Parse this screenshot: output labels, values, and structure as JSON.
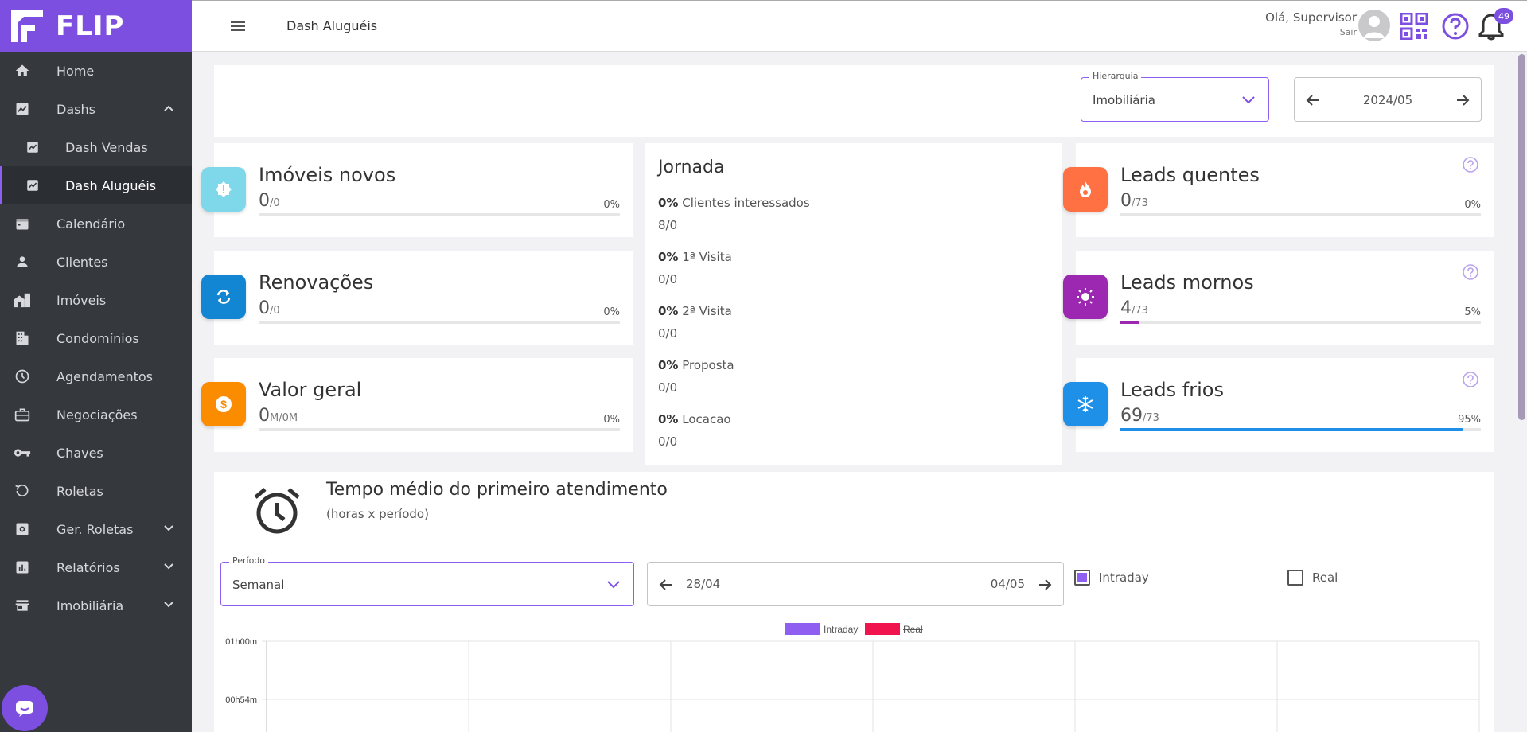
{
  "brand": {
    "name": "FLIP",
    "accent": "#7d4fe0"
  },
  "sidebar": {
    "items": [
      {
        "label": "Home",
        "icon": "home-icon"
      },
      {
        "label": "Dashs",
        "icon": "chart-icon"
      },
      {
        "label": "Dash Vendas",
        "icon": "chart-icon"
      },
      {
        "label": "Dash Aluguéis",
        "icon": "chart-icon"
      },
      {
        "label": "Calendário",
        "icon": "calendar-icon"
      },
      {
        "label": "Clientes",
        "icon": "person-icon"
      },
      {
        "label": "Imóveis",
        "icon": "buildings-icon"
      },
      {
        "label": "Condomínios",
        "icon": "apartment-icon"
      },
      {
        "label": "Agendamentos",
        "icon": "clock-icon"
      },
      {
        "label": "Negociações",
        "icon": "briefcase-icon"
      },
      {
        "label": "Chaves",
        "icon": "key-icon"
      },
      {
        "label": "Roletas",
        "icon": "rotate-icon"
      },
      {
        "label": "Ger. Roletas",
        "icon": "settings-box-icon"
      },
      {
        "label": "Relatórios",
        "icon": "report-icon"
      },
      {
        "label": "Imobiliária",
        "icon": "store-icon"
      }
    ]
  },
  "topbar": {
    "title": "Dash Aluguéis",
    "greeting": "Olá, Supervisor",
    "logout": "Sair",
    "notifications": "49"
  },
  "filters": {
    "hierarchy_label": "Hierarquia",
    "hierarchy_value": "Imobiliária",
    "period_value": "2024/05"
  },
  "cards": {
    "imoveis": {
      "title": "Imóveis novos",
      "value": "0",
      "total": "/0",
      "pct": "0%",
      "fill": 0
    },
    "renovacoes": {
      "title": "Renovações",
      "value": "0",
      "total": "/0",
      "pct": "0%",
      "fill": 0
    },
    "valor": {
      "title": "Valor geral",
      "value": "0",
      "total": "M/0M",
      "pct": "0%",
      "fill": 0
    },
    "quentes": {
      "title": "Leads quentes",
      "value": "0",
      "total": "/73",
      "pct": "0%",
      "fill": 0
    },
    "mornos": {
      "title": "Leads mornos",
      "value": "4",
      "total": "/73",
      "pct": "5%",
      "fill": 0.05
    },
    "frios": {
      "title": "Leads frios",
      "value": "69",
      "total": "/73",
      "pct": "95%",
      "fill": 0.95
    }
  },
  "jornada": {
    "title": "Jornada",
    "stages": [
      {
        "pct": "0%",
        "label": " Clientes interessados",
        "count": "8/0"
      },
      {
        "pct": "0%",
        "label": " 1ª Visita",
        "count": "0/0"
      },
      {
        "pct": "0%",
        "label": " 2ª Visita",
        "count": "0/0"
      },
      {
        "pct": "0%",
        "label": " Proposta",
        "count": "0/0"
      },
      {
        "pct": "0%",
        "label": " Locacao",
        "count": "0/0"
      }
    ]
  },
  "tempo": {
    "title": "Tempo médio do primeiro atendimento",
    "subtitle": "(horas x período)",
    "periodo_label": "Período",
    "periodo_value": "Semanal",
    "range_start": "28/04",
    "range_end": "04/05",
    "intraday_label": "Intraday",
    "real_label": "Real"
  },
  "chart_data": {
    "type": "line",
    "series": [
      {
        "name": "Intraday",
        "color": "#8e5ff0",
        "values": []
      },
      {
        "name": "Real",
        "color": "#f0134d",
        "values": [],
        "hidden": true
      }
    ],
    "y_ticks": [
      "01h00m",
      "00h54m"
    ],
    "legend_position": "top-center",
    "grid": true
  }
}
